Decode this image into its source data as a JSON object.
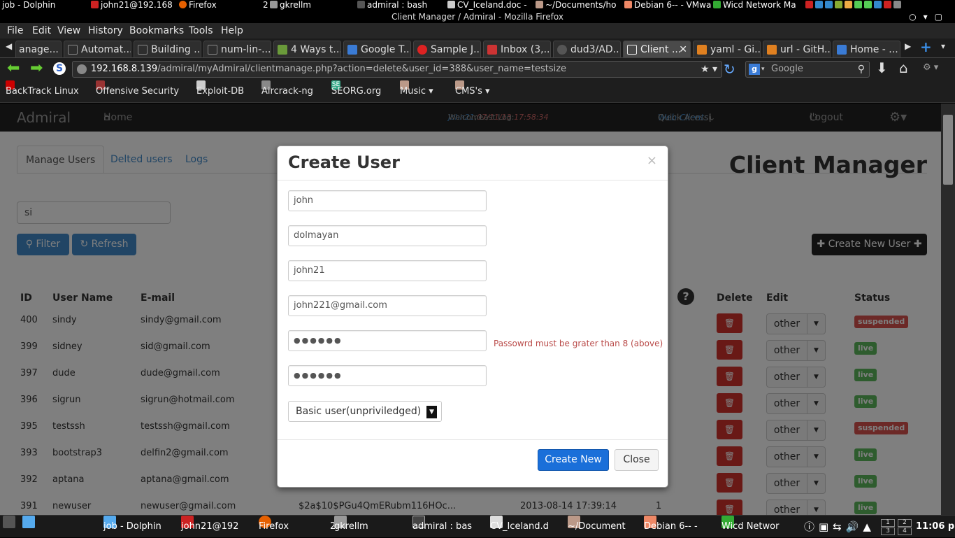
{
  "os_top": {
    "items": [
      "job - Dolphin",
      "john21@192.168",
      "Firefox",
      "2",
      "gkrellm",
      "admiral : bash",
      "CV_Iceland.doc -",
      "~/Documents/ho",
      "Debian 6-- - VMwa",
      "Wicd Network Ma"
    ]
  },
  "window": {
    "title": "Client Manager / Admiral - Mozilla Firefox"
  },
  "menu": [
    "File",
    "Edit",
    "View",
    "History",
    "Bookmarks",
    "Tools",
    "Help"
  ],
  "tabs": [
    {
      "label": "anage...",
      "color": "#444"
    },
    {
      "label": "Automat...",
      "color": "#444"
    },
    {
      "label": "Building ...",
      "color": "#444"
    },
    {
      "label": "num-lin-...",
      "color": "#444"
    },
    {
      "label": "4 Ways t...",
      "color": "#6a9a3a"
    },
    {
      "label": "Google T...",
      "color": "#3a7bd5"
    },
    {
      "label": "Sample J...",
      "color": "#d22"
    },
    {
      "label": "Inbox (3,...",
      "color": "#c33"
    },
    {
      "label": "dud3/AD...",
      "color": "#333"
    },
    {
      "label": "Client ...",
      "color": "#ddd"
    },
    {
      "label": "yaml - Gi...",
      "color": "#e08020"
    },
    {
      "label": "url - GitH...",
      "color": "#e08020"
    },
    {
      "label": "Home - ...",
      "color": "#3a7bd5"
    }
  ],
  "nav": {
    "url_host": "192.168.8.139",
    "url_path": "/admiral/myAdmiral/clientmanage.php?action=delete&user_id=388&user_name=testsize",
    "search_placeholder": "Google"
  },
  "bookmarks": [
    {
      "label": "BackTrack Linux",
      "color": "#c00"
    },
    {
      "label": "Offensive Security",
      "color": "#933"
    },
    {
      "label": "Exploit-DB",
      "color": "#ccc"
    },
    {
      "label": "Aircrack-ng",
      "color": "#888"
    },
    {
      "label": "SEORG.org",
      "color": "#3a8"
    },
    {
      "label": "Music ▾",
      "color": "#b98"
    },
    {
      "label": "CMS's ▾",
      "color": "#b98"
    }
  ],
  "app_nav": {
    "brand": "Admiral",
    "home": "Home",
    "welcome_prefix": "Welcome",
    "welcome_user": "john21",
    "last_log_label": ", Last Log:",
    "last_log": "07/11/13 17:58:34",
    "quick_access_label": "Quick Acess(",
    "quick_access_link": "Web-Clients",
    "quick_access_suffix": ")",
    "logout": "Logout"
  },
  "page": {
    "tabs": [
      "Manage Users",
      "Delted users",
      "Logs"
    ],
    "title": "Client Manager",
    "filter_value": "si",
    "filter_button": "Filter",
    "refresh_button": "Refresh",
    "create_user_button": "Create New User"
  },
  "table": {
    "headers": {
      "id": "ID",
      "username": "User Name",
      "email": "E-mail",
      "delete": "Delete",
      "edit": "Edit",
      "status": "Status"
    },
    "edit_label": "other",
    "rows": [
      {
        "id": "400",
        "username": "sindy",
        "email": "sindy@gmail.com",
        "status": "suspended"
      },
      {
        "id": "399",
        "username": "sidney",
        "email": "sid@gmail.com",
        "status": "live"
      },
      {
        "id": "397",
        "username": "dude",
        "email": "dude@gmail.com",
        "status": "live"
      },
      {
        "id": "396",
        "username": "sigrun",
        "email": "sigrun@hotmail.com",
        "status": "live"
      },
      {
        "id": "395",
        "username": "testssh",
        "email": "testssh@gmail.com",
        "status": "suspended"
      },
      {
        "id": "393",
        "username": "bootstrap3",
        "email": "delfin2@gmail.com",
        "status": "live"
      },
      {
        "id": "392",
        "username": "aptana",
        "email": "aptana@gmail.com",
        "status": "live"
      },
      {
        "id": "391",
        "username": "newuser",
        "email": "newuser@gmail.com",
        "status": "live",
        "hash": "$2a$10$PGu4QmERubm116HOc...",
        "created": "2013-08-14 17:39:14",
        "count": "1"
      }
    ]
  },
  "modal": {
    "title": "Create User",
    "close_x": "×",
    "first_name": "john",
    "last_name": "dolmayan",
    "username": "john21",
    "email": "john221@gmail.com",
    "password_mask": "●●●●●●",
    "confirm_mask": "●●●●●●",
    "password_error": "Passowrd must be grater than 8 (above)",
    "role": "Basic user(unpriviledged)",
    "create_button": "Create New",
    "close_button": "Close"
  },
  "os_bottom": {
    "items": [
      "job - Dolphin",
      "john21@192",
      "Firefox",
      "2",
      "gkrellm",
      "admiral : bas",
      "CV_Iceland.d",
      "~/Document",
      "Debian 6-- -",
      "Wicd Networ"
    ],
    "clock": "11:06 pm",
    "pager": [
      "1",
      "2",
      "3",
      "4"
    ]
  }
}
